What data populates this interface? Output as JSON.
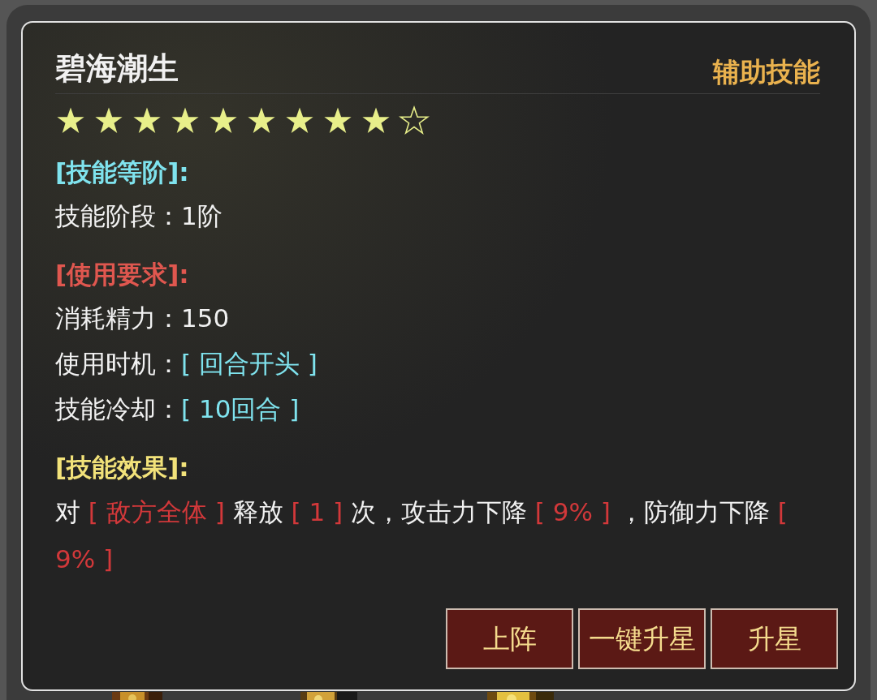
{
  "skill": {
    "name": "碧海潮生",
    "type": "辅助技能",
    "stars": 9
  },
  "sections": [
    {
      "title": "[技能等阶]:",
      "color": "#7fe3ee",
      "lines": [
        {
          "label": "技能阶段：",
          "value": "1阶",
          "kind": "plain"
        }
      ]
    },
    {
      "title": "[使用要求]:",
      "color": "#e0574f",
      "lines": [
        {
          "label": "消耗精力：",
          "value": "150",
          "kind": "plain"
        },
        {
          "label": "使用时机：",
          "value": "[ 回合开头 ]",
          "kind": "bracket"
        },
        {
          "label": "技能冷却：",
          "value": "[ 10回合 ]",
          "kind": "bracket"
        }
      ]
    },
    {
      "title": "[技能效果]:",
      "color": "#f2e27a",
      "effect": [
        {
          "text": "对 ",
          "kind": "plain"
        },
        {
          "text": "[ 敌方全体 ]",
          "kind": "highlight"
        },
        {
          "text": " 释放 ",
          "kind": "plain"
        },
        {
          "text": "[ 1 ]",
          "kind": "highlight"
        },
        {
          "text": " 次，攻击力下降 ",
          "kind": "plain"
        },
        {
          "text": "[ 9% ]",
          "kind": "highlight"
        },
        {
          "text": " ，防御力下降 ",
          "kind": "plain"
        },
        {
          "text": "[ 9% ]",
          "kind": "highlight"
        }
      ]
    }
  ],
  "buttons": [
    "上阵",
    "一键升星",
    "升星"
  ]
}
